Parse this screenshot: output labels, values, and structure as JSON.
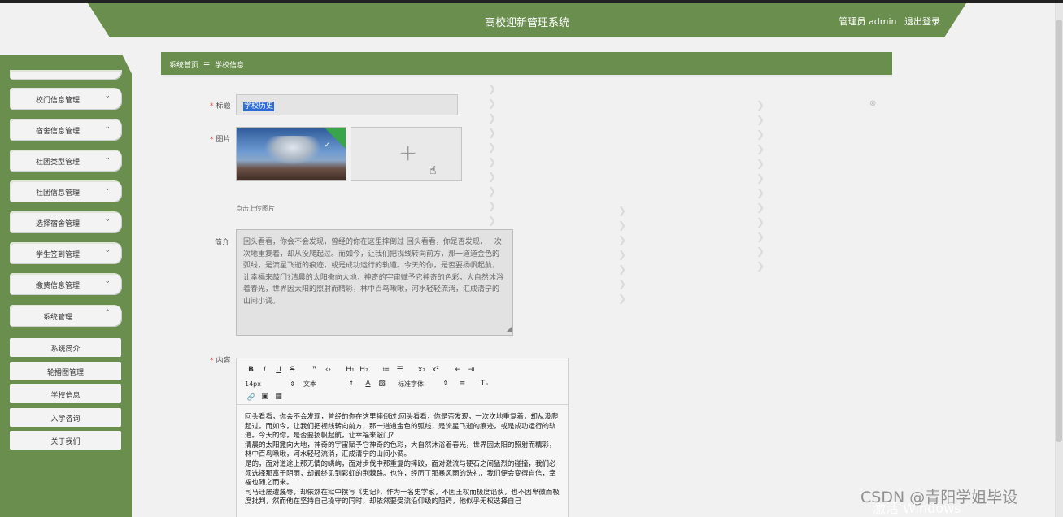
{
  "header": {
    "title": "高校迎新管理系统",
    "user": "管理员 admin",
    "logout": "退出登录"
  },
  "sidebar": {
    "items": [
      {
        "label": "校门信息管理"
      },
      {
        "label": "宿舍信息管理"
      },
      {
        "label": "社团类型管理"
      },
      {
        "label": "社团信息管理"
      },
      {
        "label": "选择宿舍管理"
      },
      {
        "label": "学生签到管理"
      },
      {
        "label": "缴费信息管理"
      },
      {
        "label": "系统管理"
      }
    ],
    "subitems": [
      {
        "label": "系统简介"
      },
      {
        "label": "轮播图管理"
      },
      {
        "label": "学校信息"
      },
      {
        "label": "入学咨询"
      },
      {
        "label": "关于我们"
      }
    ]
  },
  "breadcrumb": {
    "home": "系统首页",
    "separator": "☰",
    "current": "学校信息"
  },
  "form": {
    "title_label": "标题",
    "title_value": "学校历史",
    "image_label": "图片",
    "upload_hint": "点击上传图片",
    "intro_label": "简介",
    "intro_text": "回头看看，你会不会发现，曾经的你在这里摔倒过 回头看看，你是否发现，一次次地重复着，却从没爬起过。而如今，让我们把视线转向前方，那一道道金色的弧线，是流星飞逝的痕迹，或是成功运行的轨道。今天的你，是否要扬帆起航，让幸福来敲门?清晨的太阳撒向大地，神奇的宇宙赋予它神奇的色彩，大自然沐浴着春光，世界因太阳的照射而精彩，林中百鸟啾啾，河水轻轻流淌，汇成清宁的山间小调。",
    "content_label": "内容",
    "content_text": "回头看看，你会不会发现，曾经的你在这里摔倒过;回头看看，你是否发现，一次次地重复着，却从没爬起过。而如今，让我们把视线转向前方，那一道道金色的弧线，是流星飞逝的痕迹，或是成功运行的轨道。今天的你，是否要扬帆起航，让幸福来敲门?\n清晨的太阳撒向大地，神奇的宇宙赋予它神奇的色彩，大自然沐浴着春光，世界因太阳的照射而精彩，林中百鸟啾啾，河水轻轻流淌，汇成清宁的山间小调。\n是的，面对道途上那无情的嶙峋，面对步伐中那重复的摔跤，面对激流与硬石之间猛烈的碰撞，我们必须选择那富于阴雨，却最终见到彩虹的荆棘路。也许，经历了那暴风雨的洗礼，我们便会变得自信，幸福也随之而来。\n司马迁屡遭蔑辱，却依然在狱中撰写《史记》，作为一名史学家，不因王权而极度谄谀，也不因卑微而极度批判，然而他在坚持自己操守的同时，却依然要受流沿仰级的阻碍，他似乎无权选择自己"
  },
  "editor": {
    "font_size": "14px",
    "block_type": "文本",
    "font_family": "标准字体",
    "toolbar_row1": [
      "B",
      "I",
      "U",
      "S",
      "❞",
      "‹›",
      "H₁",
      "H₂",
      "≔",
      "☰",
      "x₂",
      "x²",
      "⇤",
      "⇥"
    ],
    "toolbar_row2_tail": [
      "A",
      "▨",
      "≡",
      "Tₓ"
    ],
    "toolbar_row3": [
      "🔗",
      "▣",
      "▦"
    ]
  },
  "watermark": {
    "text1": "CSDN @青阳学姐毕设",
    "text2": "激活 Windows"
  },
  "colors": {
    "accent": "#6a8e4e",
    "required": "#e2544a",
    "selection": "#2e6bd6"
  },
  "icons": [
    "chevron-down-icon",
    "chevron-up-icon",
    "plus-icon",
    "cursor-hand-icon",
    "check-icon",
    "clear-icon",
    "resize-handle-icon"
  ]
}
